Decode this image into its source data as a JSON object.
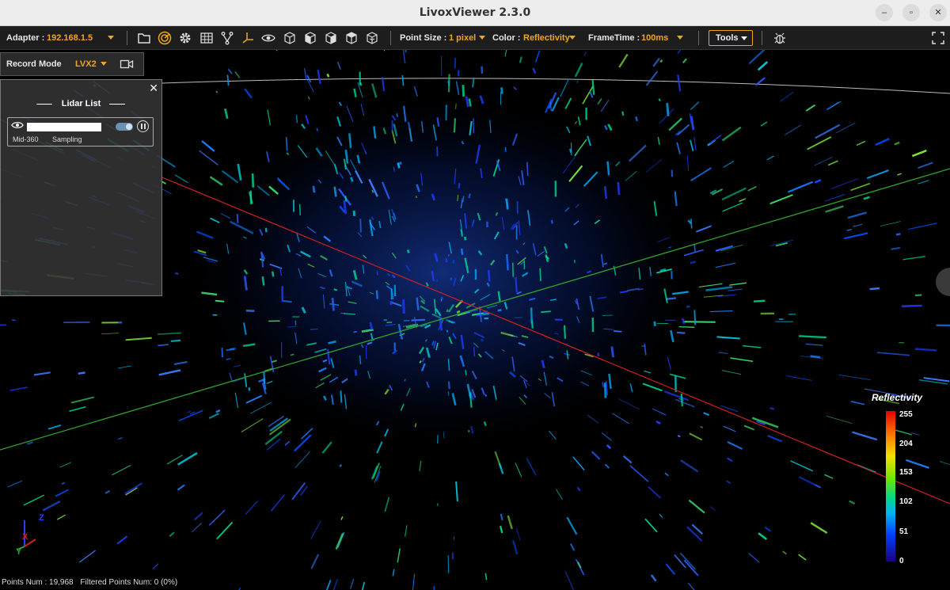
{
  "window": {
    "title": "LivoxViewer 2.3.0"
  },
  "toolbar": {
    "adapter_label": "Adapter :",
    "adapter_value": "192.168.1.5",
    "point_size_label": "Point Size :",
    "point_size_value": "1 pixel",
    "color_label": "Color :",
    "color_value": "Reflectivity",
    "frametime_label": "FrameTime :",
    "frametime_value": "100ms",
    "tools_label": "Tools",
    "icons": [
      "folder-icon",
      "radar-icon",
      "gear-icon",
      "grid-icon",
      "filter-icon",
      "axis-icon",
      "eye-icon",
      "cube-icon",
      "cube-front-icon",
      "cube-side-icon",
      "cube-top-icon",
      "cube-iso-icon",
      "bug-icon",
      "fullscreen-icon"
    ]
  },
  "record": {
    "label": "Record Mode",
    "value": "LVX2"
  },
  "lidar_list": {
    "title": "Lidar List",
    "devices": [
      {
        "model": "Mid-360",
        "status": "Sampling",
        "enabled": true
      }
    ]
  },
  "legend": {
    "title": "Reflectivity",
    "ticks": [
      "255",
      "204",
      "153",
      "102",
      "51",
      "0"
    ]
  },
  "axes": {
    "z": "Z",
    "x": "X",
    "y": "Y"
  },
  "status": {
    "points": "Points Num : 19,968",
    "filtered": "Filtered Points Num: 0 (0%)"
  },
  "colors": {
    "accent": "#f0a51e",
    "x_axis": "#d01e1e",
    "y_axis": "#2fa32f",
    "z_axis": "#2a3cff"
  }
}
